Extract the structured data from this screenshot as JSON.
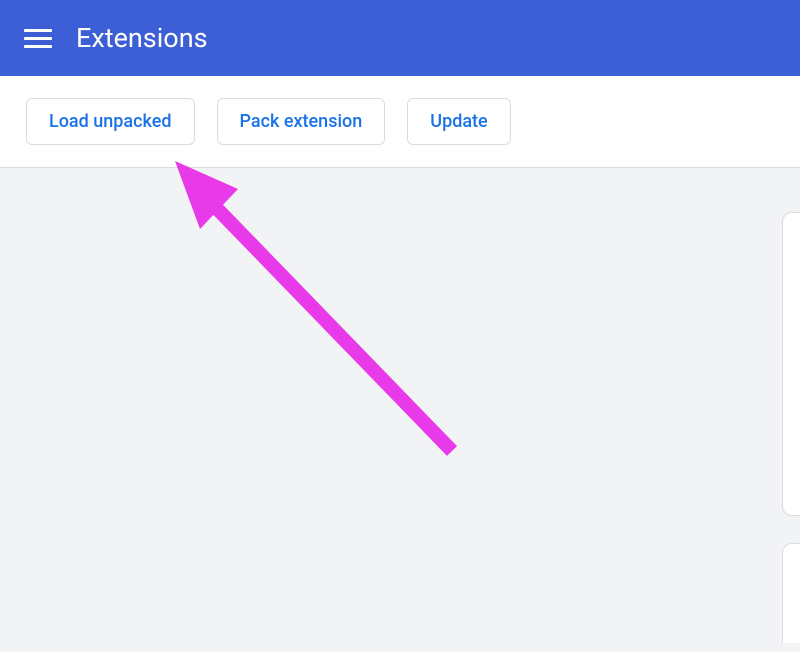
{
  "header": {
    "title": "Extensions"
  },
  "toolbar": {
    "load_unpacked_label": "Load unpacked",
    "pack_extension_label": "Pack extension",
    "update_label": "Update"
  },
  "annotation": {
    "arrow_color": "#e83ae8",
    "points_to": "load-unpacked-button"
  }
}
